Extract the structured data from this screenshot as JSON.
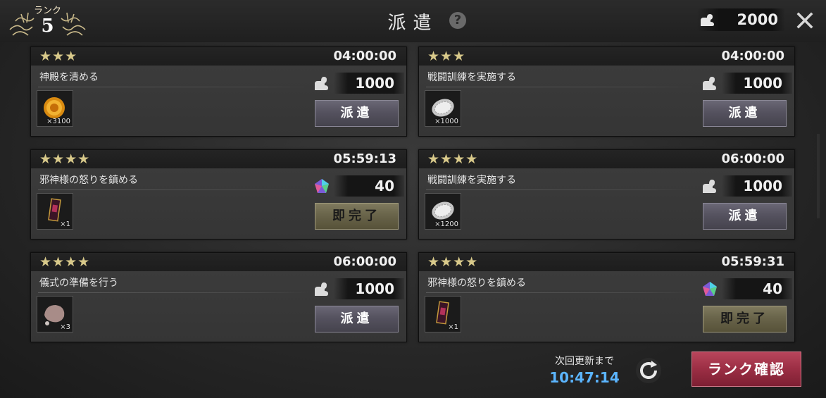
{
  "header": {
    "rank_label": "ランク",
    "rank_value": "5",
    "title": "派遣",
    "stamina": "2000"
  },
  "missions": [
    {
      "stars": "★★★",
      "time": "04:00:00",
      "name": "神殿を清める",
      "cost_type": "stamina",
      "cost": "1000",
      "item": "gold-coin",
      "count": "×3100",
      "button": "派遣",
      "button_type": "dispatch"
    },
    {
      "stars": "★★★",
      "time": "04:00:00",
      "name": "戦闘訓練を実施する",
      "cost_type": "stamina",
      "cost": "1000",
      "item": "silver-coin",
      "count": "×1000",
      "button": "派遣",
      "button_type": "dispatch"
    },
    {
      "stars": "★★★★",
      "time": "05:59:13",
      "name": "邪神様の怒りを鎮める",
      "cost_type": "gem",
      "cost": "40",
      "item": "ticket",
      "count": "×1",
      "button": "即完了",
      "button_type": "complete"
    },
    {
      "stars": "★★★★",
      "time": "06:00:00",
      "name": "戦闘訓練を実施する",
      "cost_type": "stamina",
      "cost": "1000",
      "item": "silver-coin",
      "count": "×1200",
      "button": "派遣",
      "button_type": "dispatch"
    },
    {
      "stars": "★★★★",
      "time": "06:00:00",
      "name": "儀式の準備を行う",
      "cost_type": "stamina",
      "cost": "1000",
      "item": "stone",
      "count": "×3",
      "button": "派遣",
      "button_type": "dispatch"
    },
    {
      "stars": "★★★★",
      "time": "05:59:31",
      "name": "邪神様の怒りを鎮める",
      "cost_type": "gem",
      "cost": "40",
      "item": "ticket",
      "count": "×1",
      "button": "即完了",
      "button_type": "complete"
    }
  ],
  "footer": {
    "next_update_label": "次回更新まで",
    "next_update_time": "10:47:14",
    "rank_button": "ランク確認"
  },
  "colors": {
    "accent_blue": "#5bb5ff",
    "rank_button": "#9b2e44",
    "stars": "#d8c98a"
  }
}
